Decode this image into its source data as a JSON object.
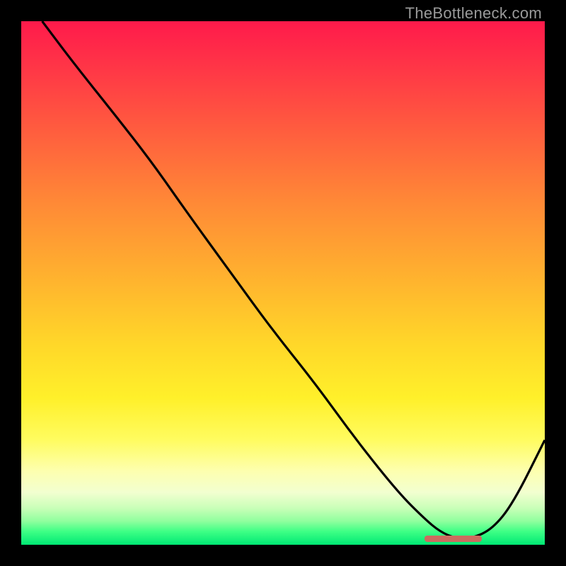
{
  "watermark": "TheBottleneck.com",
  "chart_data": {
    "type": "line",
    "title": "",
    "xlabel": "",
    "ylabel": "",
    "xlim": [
      0,
      100
    ],
    "ylim": [
      0,
      100
    ],
    "grid": false,
    "legend": false,
    "series": [
      {
        "name": "bottleneck-curve",
        "x": [
          4,
          10,
          18,
          25,
          32,
          40,
          48,
          56,
          64,
          72,
          77,
          80,
          83,
          86,
          90,
          94,
          100
        ],
        "y": [
          100,
          92,
          82,
          73,
          63,
          52,
          41,
          31,
          20,
          10,
          5,
          2.5,
          1.2,
          1.2,
          3,
          8,
          20
        ]
      }
    ],
    "marker": {
      "name": "optimal-range",
      "x_start": 77,
      "x_end": 88,
      "y": 1.2,
      "color": "#cc6b5f"
    },
    "background_gradient": {
      "top": "#ff1a4b",
      "mid_high": "#ff8a36",
      "mid": "#ffd829",
      "mid_low": "#fdffb0",
      "bottom": "#00e874"
    }
  }
}
